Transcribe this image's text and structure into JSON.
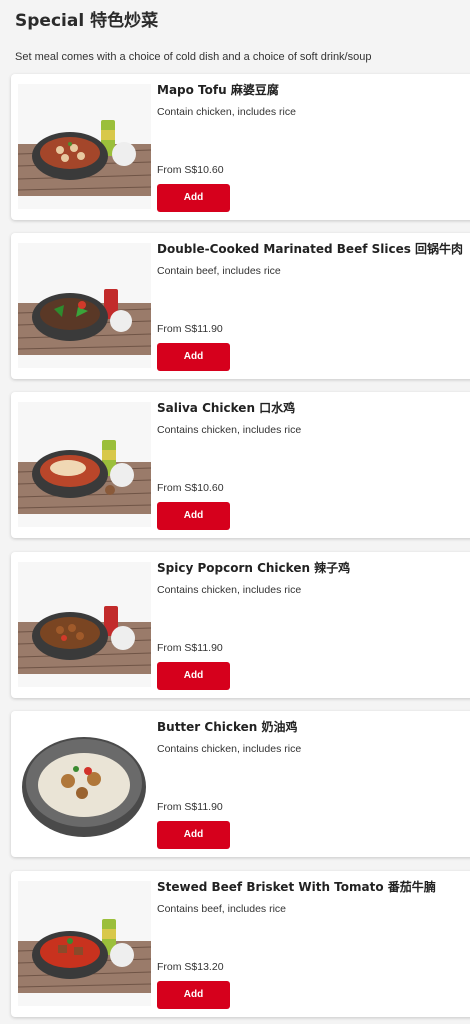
{
  "section": {
    "title": "Special 特色炒菜",
    "subtitle": "Set meal comes with a choice of cold dish and a choice of soft drink/soup"
  },
  "items": [
    {
      "name": "Mapo Tofu 麻婆豆腐",
      "desc": "Contain chicken, includes rice",
      "price": "From S$10.60",
      "add_label": "Add"
    },
    {
      "name": "Double-Cooked Marinated Beef Slices 回锅牛肉",
      "desc": "Contain beef, includes rice",
      "price": "From S$11.90",
      "add_label": "Add"
    },
    {
      "name": "Saliva Chicken 口水鸡",
      "desc": "Contains chicken, includes rice",
      "price": "From S$10.60",
      "add_label": "Add"
    },
    {
      "name": "Spicy Popcorn Chicken 辣子鸡",
      "desc": "Contains chicken, includes rice",
      "price": "From S$11.90",
      "add_label": "Add"
    },
    {
      "name": "Butter Chicken 奶油鸡",
      "desc": "Contains chicken, includes rice",
      "price": "From S$11.90",
      "add_label": "Add"
    },
    {
      "name": "Stewed Beef Brisket With Tomato 番茄牛腩",
      "desc": "Contains beef, includes rice",
      "price": "From S$13.20",
      "add_label": "Add"
    }
  ]
}
